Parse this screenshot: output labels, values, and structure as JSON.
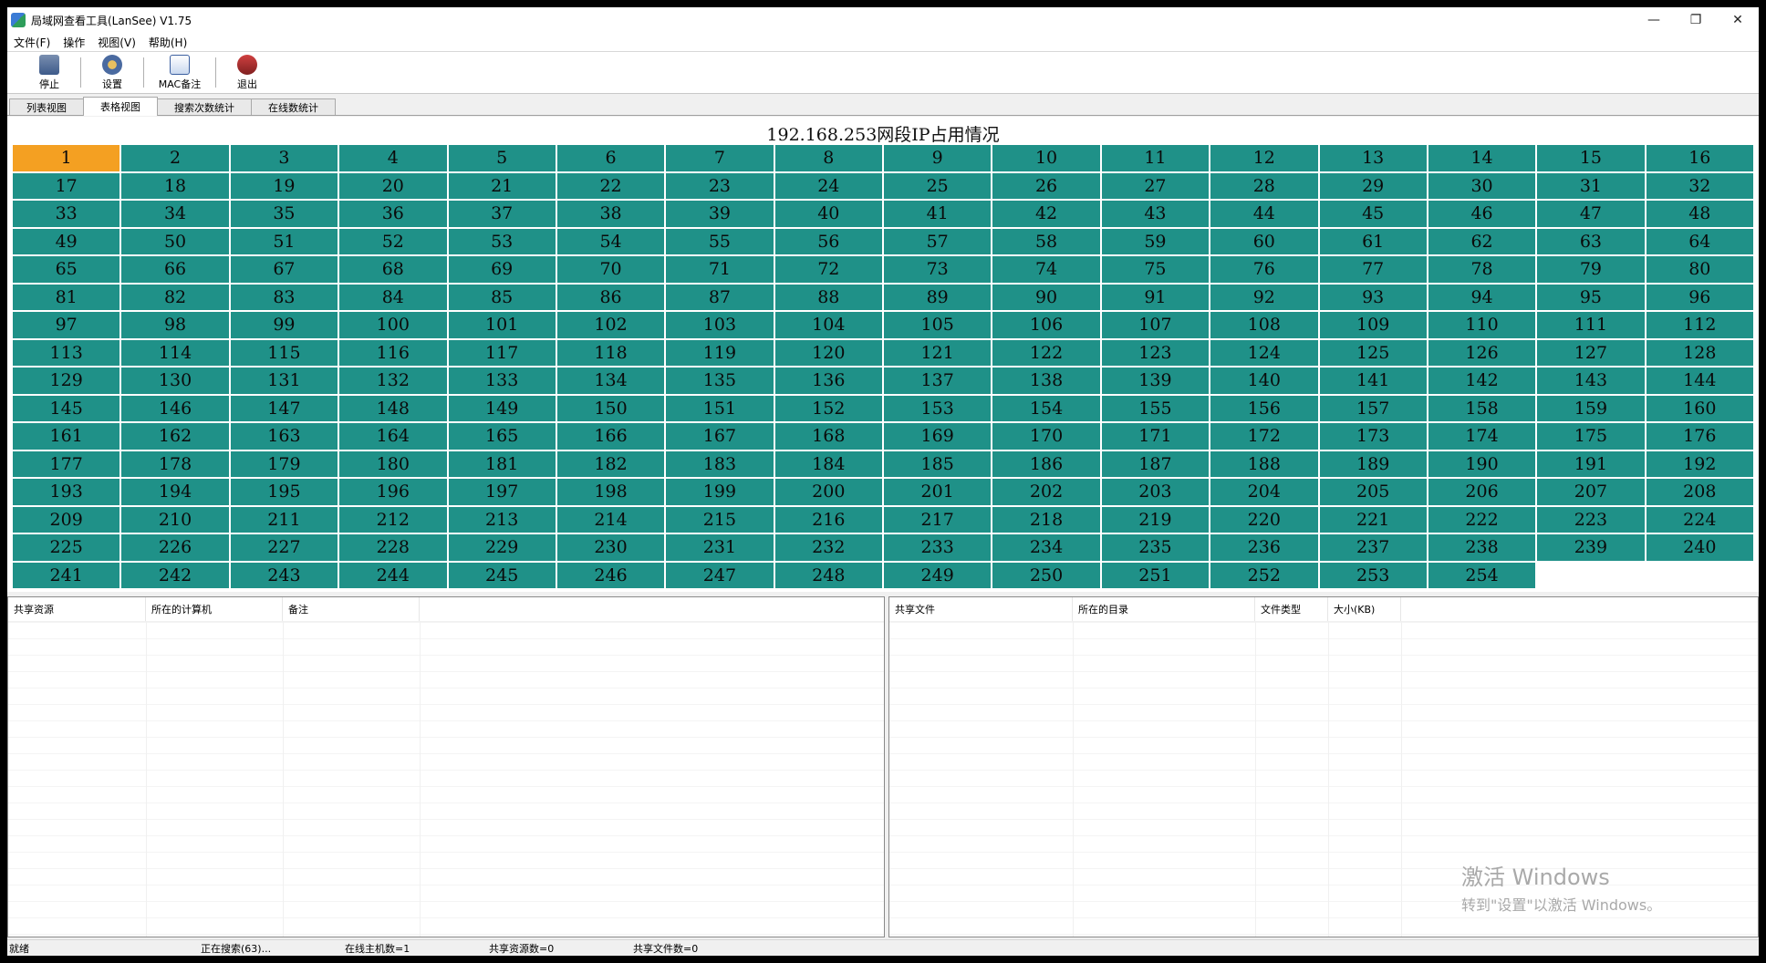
{
  "window": {
    "title": "局域网查看工具(LanSee) V1.75",
    "controls": {
      "minimize": "—",
      "maximize": "❐",
      "close": "✕"
    }
  },
  "menu": [
    "文件(F)",
    "操作",
    "视图(V)",
    "帮助(H)"
  ],
  "toolbar": {
    "stop": "停止",
    "settings": "设置",
    "mac_note": "MAC备注",
    "exit": "退出"
  },
  "tabs": [
    "列表视图",
    "表格视图",
    "搜索次数统计",
    "在线数统计"
  ],
  "active_tab": 1,
  "grid": {
    "title": "192.168.253网段IP占用情况",
    "ip_count": 254,
    "active_ips": [
      1
    ],
    "colors": {
      "online": "#1f9188",
      "active": "#f4a022"
    }
  },
  "share_panel": {
    "columns": [
      "共享资源",
      "所在的计算机",
      "备注"
    ]
  },
  "file_panel": {
    "columns": [
      "共享文件",
      "所在的目录",
      "文件类型",
      "大小(KB)"
    ]
  },
  "watermark": {
    "title": "激活 Windows",
    "subtitle": "转到\"设置\"以激活 Windows。"
  },
  "status": {
    "ready": "就绪",
    "searching": "正在搜索(63)...",
    "online_hosts": "在线主机数=1",
    "shared_resources": "共享资源数=0",
    "shared_files": "共享文件数=0"
  }
}
